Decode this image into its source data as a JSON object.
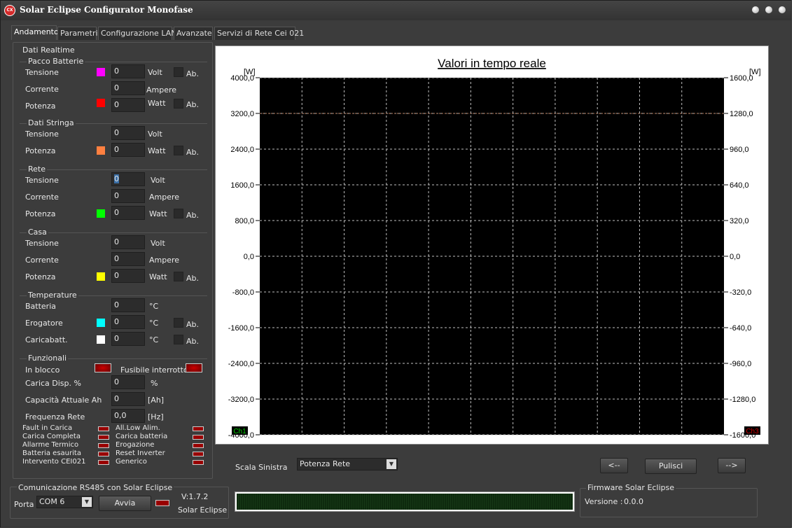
{
  "window": {
    "title": "Solar Eclipse Configurator Monofase",
    "icon_text": "CX"
  },
  "tabs": [
    "Andamento",
    "Parametri",
    "Configurazione LAN",
    "Avanzate",
    "Servizi di Rete Cei 021"
  ],
  "left": {
    "title": "Dati Realtime",
    "battery": {
      "title": "Pacco Batterie",
      "rows": [
        {
          "label": "Tensione",
          "value": "0",
          "unit": "Volt",
          "check": "Ab."
        },
        {
          "label": "Corrente",
          "value": "0",
          "unit": "Ampere"
        },
        {
          "label": "Potenza",
          "value": "0",
          "unit": "Watt",
          "check": "Ab."
        }
      ]
    },
    "string": {
      "title": "Dati Stringa",
      "rows": [
        {
          "label": "Tensione",
          "value": "0",
          "unit": "Volt"
        },
        {
          "label": "Potenza",
          "value": "0",
          "unit": "Watt",
          "check": "Ab."
        }
      ]
    },
    "grid": {
      "title": "Rete",
      "rows": [
        {
          "label": "Tensione",
          "value": "0",
          "unit": "Volt"
        },
        {
          "label": "Corrente",
          "value": "0",
          "unit": "Ampere"
        },
        {
          "label": "Potenza",
          "value": "0",
          "unit": "Watt",
          "check": "Ab."
        }
      ]
    },
    "house": {
      "title": "Casa",
      "rows": [
        {
          "label": "Tensione",
          "value": "0",
          "unit": "Volt"
        },
        {
          "label": "Corrente",
          "value": "0",
          "unit": "Ampere"
        },
        {
          "label": "Potenza",
          "value": "0",
          "unit": "Watt",
          "check": "Ab."
        }
      ]
    },
    "temps": {
      "title": "Temperature",
      "rows": [
        {
          "label": "Batteria",
          "value": "0",
          "unit": "°C"
        },
        {
          "label": "Erogatore",
          "value": "0",
          "unit": "°C",
          "check": "Ab."
        },
        {
          "label": "Caricabatt.",
          "value": "0",
          "unit": "°C",
          "check": "Ab."
        }
      ]
    },
    "functions": {
      "title": "Funzionali",
      "in_blocco": "In blocco",
      "fusibile": "Fusibile interrotto",
      "rows": [
        {
          "label": "Carica Disp. %",
          "value": "0",
          "unit": "%"
        },
        {
          "label": "Capacità Attuale Ah",
          "value": "0",
          "unit": "[Ah]"
        },
        {
          "label": "Frequenza Rete",
          "value": "0,0",
          "unit": "[Hz]"
        }
      ],
      "status_left": [
        "Fault in Carica",
        "Carica Completa",
        "Allarme Termico",
        "Batteria esaurita",
        "Intervento CEI021"
      ],
      "status_right": [
        "All.Low Alim.",
        "Carica batteria",
        "Erogazione",
        "Reset Inverter",
        "Generico"
      ]
    },
    "colors": {
      "battery_tension": "#ff00ff",
      "battery_power": "#ff0000",
      "string_power": "#ff8040",
      "grid_power": "#00ff00",
      "house_power": "#ffff00",
      "erogatore": "#00ffff",
      "caricabatt": "#ffffff"
    }
  },
  "chart_data": {
    "type": "line",
    "title": "Valori in tempo reale",
    "ylabel_left": "[W]",
    "ylabel_right": "[W]",
    "left_ticks": [
      "4000,0",
      "3200,0",
      "2400,0",
      "1600,0",
      "800,0",
      "0,0",
      "-800,0",
      "-1600,0",
      "-2400,0",
      "-3200,0",
      "-4000,0"
    ],
    "right_ticks": [
      "1600,0",
      "1280,0",
      "960,0",
      "640,0",
      "320,0",
      "0,0",
      "-320,0",
      "-640,0",
      "-960,0",
      "-1280,0",
      "-1600,0"
    ],
    "ylim_left": [
      -4000,
      4000
    ],
    "ylim_right": [
      -1600,
      1600
    ],
    "grid": true,
    "vertical_divisions": 11,
    "reference_line_right": 1280,
    "series": [],
    "channels": [
      "Ch1",
      "Ch3"
    ],
    "colors": {
      "background": "#000000",
      "grid": "#bfbfbf",
      "ref_line": "#c08060",
      "ch1": "#00cc00",
      "ch3": "#cc0000"
    }
  },
  "controls": {
    "scala_label": "Scala Sinistra",
    "scala_value": "Potenza Rete",
    "prev_label": "<--",
    "clear_label": "Pulisci",
    "next_label": "-->"
  },
  "comm": {
    "title": "Comunicazione RS485 con  Solar Eclipse",
    "port_label": "Porta",
    "port_value": "COM 6",
    "start_label": "Avvia",
    "version": "V:1.7.2",
    "product": "Solar Eclipse"
  },
  "firmware": {
    "title": "Firmware  Solar Eclipse",
    "version_label": "Versione :",
    "version_value": "0.0.0"
  }
}
